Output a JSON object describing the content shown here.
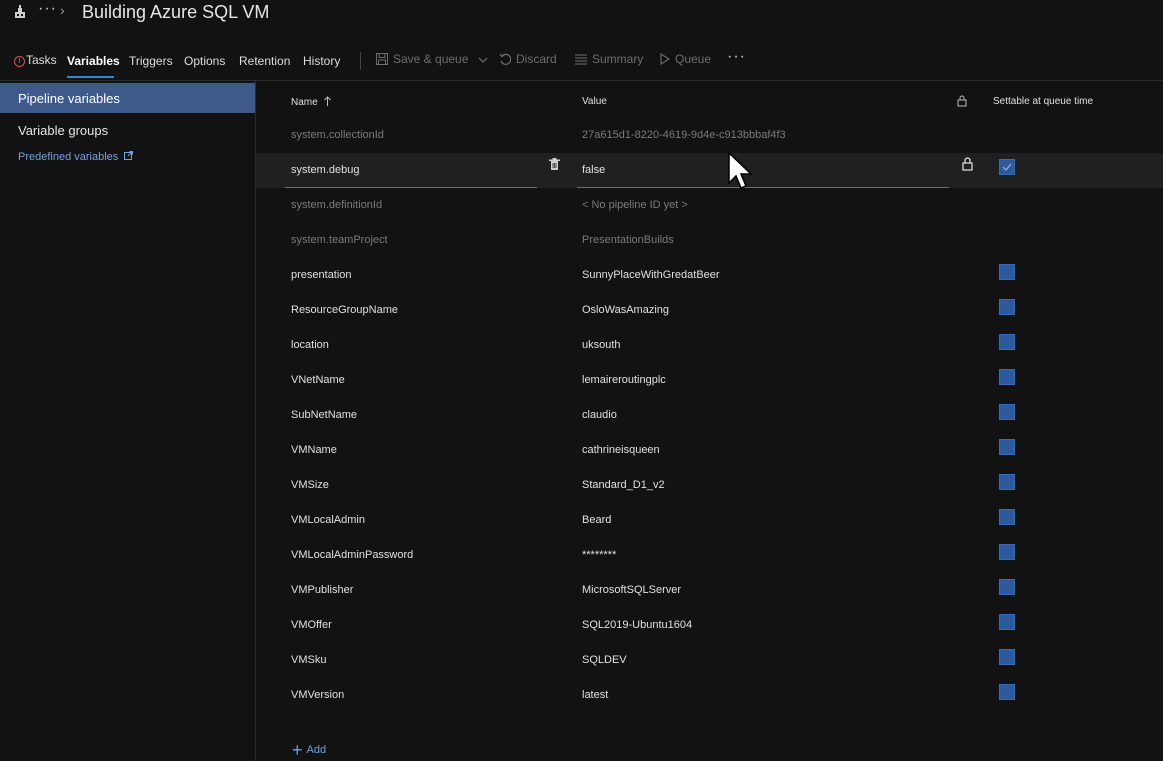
{
  "header": {
    "title": "Building Azure SQL VM",
    "breadcrumb_more": "···",
    "breadcrumb_chevron": "›"
  },
  "tabs": [
    {
      "label": "Tasks",
      "error": true
    },
    {
      "label": "Variables",
      "active": true
    },
    {
      "label": "Triggers"
    },
    {
      "label": "Options"
    },
    {
      "label": "Retention"
    },
    {
      "label": "History"
    }
  ],
  "toolbar": {
    "save_queue": "Save & queue",
    "discard": "Discard",
    "summary": "Summary",
    "queue": "Queue",
    "more": "···"
  },
  "sidebar": {
    "items": [
      {
        "label": "Pipeline variables",
        "active": true
      },
      {
        "label": "Variable groups"
      }
    ],
    "predefined_link": "Predefined variables"
  },
  "table": {
    "col_name": "Name",
    "col_value": "Value",
    "col_settable": "Settable at queue time",
    "rows": [
      {
        "name": "system.collectionId",
        "value": "27a615d1-8220-4619-9d4e-c913bbbaf4f3",
        "system": true
      },
      {
        "name": "system.debug",
        "value": "false",
        "selected": true,
        "settable": true
      },
      {
        "name": "system.definitionId",
        "value": "< No pipeline ID yet >",
        "system": true
      },
      {
        "name": "system.teamProject",
        "value": "PresentationBuilds",
        "system": true
      },
      {
        "name": "presentation",
        "value": "SunnyPlaceWithGredatBeer",
        "settable": true
      },
      {
        "name": "ResourceGroupName",
        "value": "OsloWasAmazing",
        "settable": true
      },
      {
        "name": "location",
        "value": "uksouth",
        "settable": true
      },
      {
        "name": "VNetName",
        "value": "lemaireroutingplc",
        "settable": true
      },
      {
        "name": "SubNetName",
        "value": "claudio",
        "settable": true
      },
      {
        "name": "VMName",
        "value": "cathrineisqueen",
        "settable": true
      },
      {
        "name": "VMSize",
        "value": "Standard_D1_v2",
        "settable": true
      },
      {
        "name": "VMLocalAdmin",
        "value": "Beard",
        "settable": true
      },
      {
        "name": "VMLocalAdminPassword",
        "value": "********",
        "settable": true
      },
      {
        "name": "VMPublisher",
        "value": "MicrosoftSQLServer",
        "settable": true
      },
      {
        "name": "VMOffer",
        "value": "SQL2019-Ubuntu1604",
        "settable": true
      },
      {
        "name": "VMSku",
        "value": "SQLDEV",
        "settable": true
      },
      {
        "name": "VMVersion",
        "value": "latest",
        "settable": true
      }
    ]
  },
  "add_label": "Add",
  "colors": {
    "accent": "#2b88d8",
    "checkbox": "#2d5a9e",
    "link": "#6fa3e3",
    "error": "#e0504a"
  }
}
